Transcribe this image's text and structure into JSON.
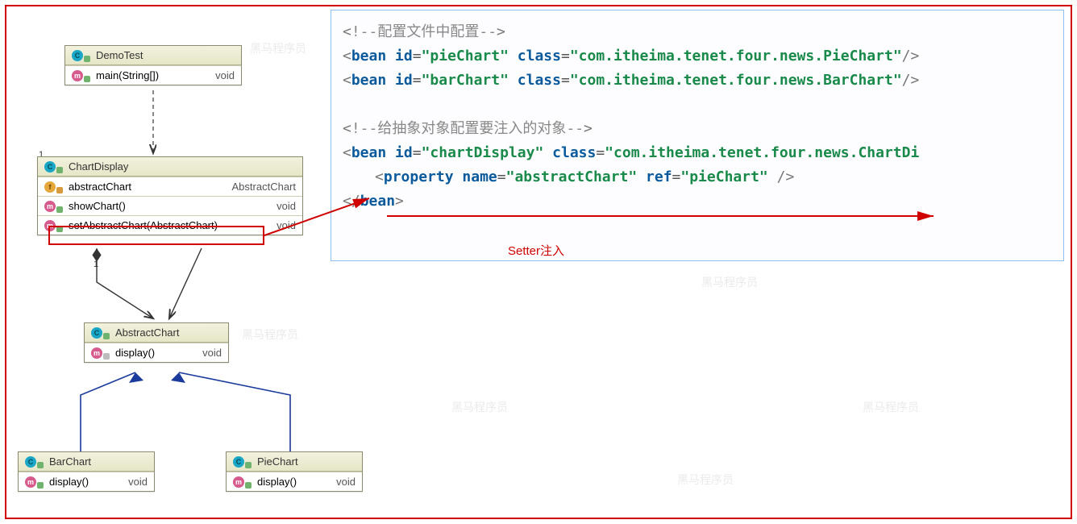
{
  "watermark": "黑马程序员",
  "uml": {
    "demoTest": {
      "name": "DemoTest",
      "members": [
        {
          "icon": "method",
          "sig": "main(String[])",
          "ret": "void"
        }
      ]
    },
    "chartDisplay": {
      "name": "ChartDisplay",
      "cornerNum": "1",
      "assocNum": "1",
      "members": [
        {
          "icon": "field",
          "sig": "abstractChart",
          "ret": "AbstractChart"
        },
        {
          "icon": "method",
          "sig": "showChart()",
          "ret": "void"
        },
        {
          "icon": "method",
          "sig": "setAbstractChart(AbstractChart)",
          "ret": "void"
        }
      ]
    },
    "abstractChart": {
      "name": "AbstractChart",
      "members": [
        {
          "icon": "method",
          "sig": "display()",
          "ret": "void"
        }
      ]
    },
    "barChart": {
      "name": "BarChart",
      "members": [
        {
          "icon": "method",
          "sig": "display()",
          "ret": "void"
        }
      ]
    },
    "pieChart": {
      "name": "PieChart",
      "members": [
        {
          "icon": "method",
          "sig": "display()",
          "ret": "void"
        }
      ]
    }
  },
  "code": {
    "comment1": "<!--配置文件中配置-->",
    "line2": {
      "id": "pieChart",
      "class": "com.itheima.tenet.four.news.PieChart"
    },
    "line3": {
      "id": "barChart",
      "class": "com.itheima.tenet.four.news.BarChart"
    },
    "comment2": "<!--给抽象对象配置要注入的对象-->",
    "line5": {
      "id": "chartDisplay",
      "class": "com.itheima.tenet.four.news.ChartDi"
    },
    "line6": {
      "name": "abstractChart",
      "ref": "pieChart"
    },
    "closeBean": "bean"
  },
  "labels": {
    "setterInject": "Setter注入"
  }
}
